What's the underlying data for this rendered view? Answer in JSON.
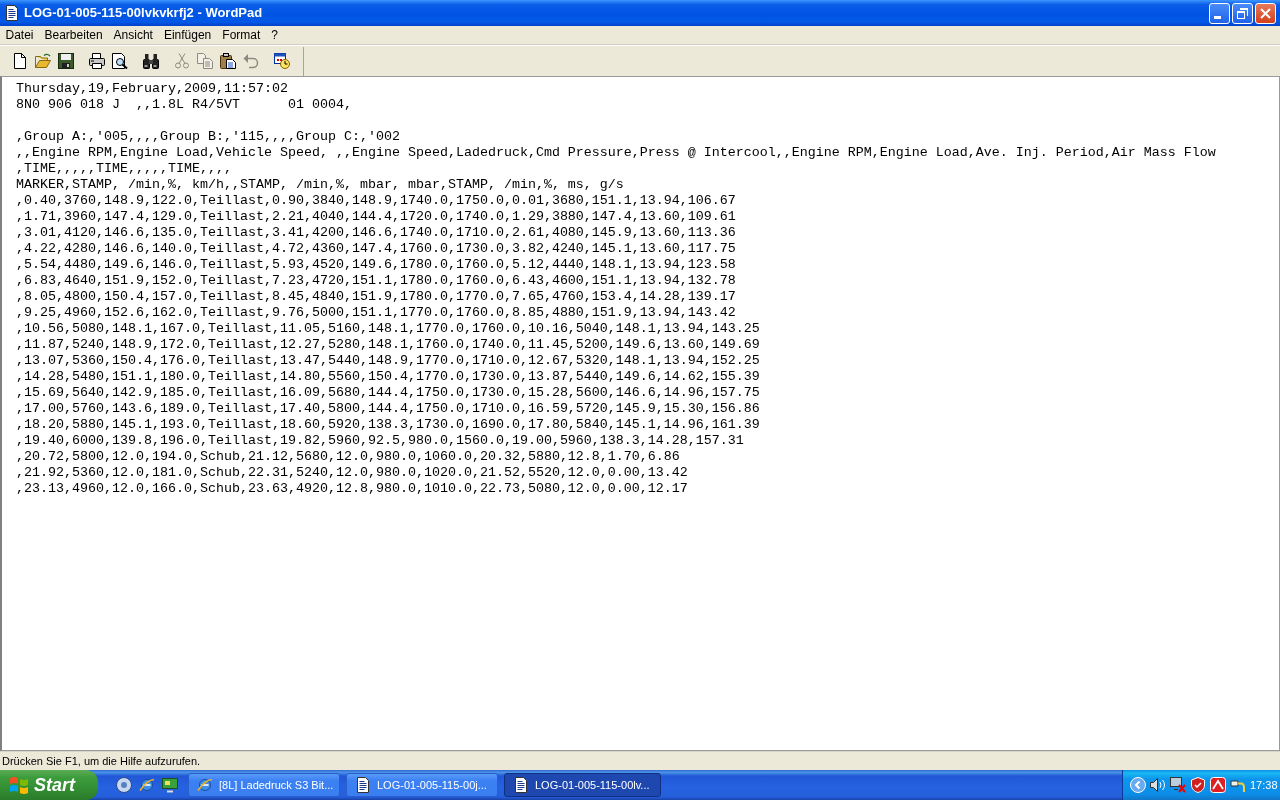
{
  "window": {
    "title": "LOG-01-005-115-00lvkvkrfj2 - WordPad"
  },
  "menu": [
    "Datei",
    "Bearbeiten",
    "Ansicht",
    "Einfügen",
    "Format",
    "?"
  ],
  "toolbar": {
    "groups": [
      [
        {
          "kind": "new",
          "disabled": false
        },
        {
          "kind": "open",
          "disabled": false
        },
        {
          "kind": "save",
          "disabled": false
        }
      ],
      [
        {
          "kind": "print",
          "disabled": false
        },
        {
          "kind": "preview",
          "disabled": false
        }
      ],
      [
        {
          "kind": "find",
          "disabled": false
        }
      ],
      [
        {
          "kind": "cut",
          "disabled": true
        },
        {
          "kind": "copy",
          "disabled": true
        },
        {
          "kind": "paste",
          "disabled": false
        },
        {
          "kind": "undo",
          "disabled": true
        }
      ],
      [
        {
          "kind": "datetime",
          "disabled": false
        }
      ]
    ]
  },
  "document": {
    "blocks": [
      [
        "Thursday,19,February,2009,11:57:02",
        "8N0 906 018 J  ,,1.8L R4/5VT      01 0004,"
      ],
      [
        ",Group A:,'005,,,,Group B:,'115,,,,Group C:,'002",
        ",,Engine RPM,Engine Load,Vehicle Speed, ,,Engine Speed,Ladedruck,Cmd Pressure,Press @ Intercool,,Engine RPM,Engine Load,Ave. Inj. Period,Air Mass Flow",
        ",TIME,,,,,TIME,,,,,TIME,,,,",
        "MARKER,STAMP, /min,%, km/h,,STAMP, /min,%, mbar, mbar,STAMP, /min,%, ms, g/s",
        ",0.40,3760,148.9,122.0,Teillast,0.90,3840,148.9,1740.0,1750.0,0.01,3680,151.1,13.94,106.67",
        ",1.71,3960,147.4,129.0,Teillast,2.21,4040,144.4,1720.0,1740.0,1.29,3880,147.4,13.60,109.61",
        ",3.01,4120,146.6,135.0,Teillast,3.41,4200,146.6,1740.0,1710.0,2.61,4080,145.9,13.60,113.36",
        ",4.22,4280,146.6,140.0,Teillast,4.72,4360,147.4,1760.0,1730.0,3.82,4240,145.1,13.60,117.75",
        ",5.54,4480,149.6,146.0,Teillast,5.93,4520,149.6,1780.0,1760.0,5.12,4440,148.1,13.94,123.58",
        ",6.83,4640,151.9,152.0,Teillast,7.23,4720,151.1,1780.0,1760.0,6.43,4600,151.1,13.94,132.78",
        ",8.05,4800,150.4,157.0,Teillast,8.45,4840,151.9,1780.0,1770.0,7.65,4760,153.4,14.28,139.17",
        ",9.25,4960,152.6,162.0,Teillast,9.76,5000,151.1,1770.0,1760.0,8.85,4880,151.9,13.94,143.42",
        ",10.56,5080,148.1,167.0,Teillast,11.05,5160,148.1,1770.0,1760.0,10.16,5040,148.1,13.94,143.25",
        ",11.87,5240,148.9,172.0,Teillast,12.27,5280,148.1,1760.0,1740.0,11.45,5200,149.6,13.60,149.69",
        ",13.07,5360,150.4,176.0,Teillast,13.47,5440,148.9,1770.0,1710.0,12.67,5320,148.1,13.94,152.25",
        ",14.28,5480,151.1,180.0,Teillast,14.80,5560,150.4,1770.0,1730.0,13.87,5440,149.6,14.62,155.39",
        ",15.69,5640,142.9,185.0,Teillast,16.09,5680,144.4,1750.0,1730.0,15.28,5600,146.6,14.96,157.75",
        ",17.00,5760,143.6,189.0,Teillast,17.40,5800,144.4,1750.0,1710.0,16.59,5720,145.9,15.30,156.86",
        ",18.20,5880,145.1,193.0,Teillast,18.60,5920,138.3,1730.0,1690.0,17.80,5840,145.1,14.96,161.39",
        ",19.40,6000,139.8,196.0,Teillast,19.82,5960,92.5,980.0,1560.0,19.00,5960,138.3,14.28,157.31",
        ",20.72,5800,12.0,194.0,Schub,21.12,5680,12.0,980.0,1060.0,20.32,5880,12.8,1.70,6.86",
        ",21.92,5360,12.0,181.0,Schub,22.31,5240,12.0,980.0,1020.0,21.52,5520,12.0,0.00,13.42",
        ",23.13,4960,12.0,166.0,Schub,23.63,4920,12.8,980.0,1010.0,22.73,5080,12.0,0.00,12.17"
      ]
    ]
  },
  "status_bar": {
    "text": "Drücken Sie F1, um die Hilfe aufzurufen."
  },
  "taskbar": {
    "start": "Start",
    "tasks": [
      {
        "kind": "browser",
        "label": "[8L] Ladedruck S3 Bit...",
        "selected": false
      },
      {
        "kind": "document",
        "label": "LOG-01-005-115-00j...",
        "selected": false
      },
      {
        "kind": "document",
        "label": "LOG-01-005-115-00lv...",
        "selected": true
      }
    ],
    "clock": "17:38"
  }
}
